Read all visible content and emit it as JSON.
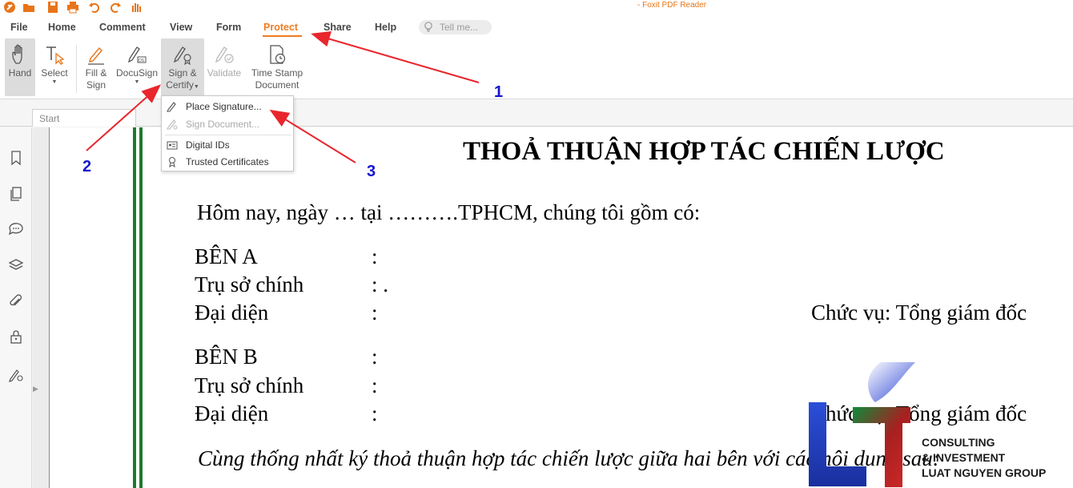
{
  "app_title": "- Foxit PDF Reader",
  "menu": {
    "tabs": [
      "File",
      "Home",
      "Comment",
      "View",
      "Form",
      "Protect",
      "Share",
      "Help"
    ],
    "active_tab": "Protect",
    "tell_me_placeholder": "Tell me..."
  },
  "ribbon": {
    "hand": "Hand",
    "select": "Select",
    "fill_sign": [
      "Fill &",
      "Sign"
    ],
    "docusign": "DocuSign",
    "sign_certify": [
      "Sign &",
      "Certify"
    ],
    "validate": "Validate",
    "time_stamp": [
      "Time Stamp",
      "Document"
    ]
  },
  "doc_tab": {
    "label": "Start"
  },
  "dropdown": {
    "place_signature": "Place Signature...",
    "sign_document": "Sign Document...",
    "digital_ids": "Digital IDs",
    "trusted_certificates": "Trusted Certificates"
  },
  "document": {
    "title": "THOẢ THUẬN HỢP TÁC CHIẾN LƯỢC",
    "intro": "Hôm nay, ngày  … tại ……….TPHCM, chúng tôi gồm có:",
    "party_a": {
      "label": "BÊN A",
      "colon": ":"
    },
    "office_a": {
      "label": "Trụ sở chính",
      "colon": ": ."
    },
    "rep_a": {
      "label": "Đại diện",
      "colon": ":",
      "position": "Chức vụ: Tổng giám đốc"
    },
    "party_b": {
      "label": "BÊN B",
      "colon": ":"
    },
    "office_b": {
      "label": "Trụ sở chính",
      "colon": ":"
    },
    "rep_b": {
      "label": "Đại diện",
      "colon": ":",
      "position": "Chức vụ: Tổng giám đốc"
    },
    "closing": "Cùng thống nhất ký thoả thuận hợp tác chiến lược giữa hai bên với các nội dung sau:"
  },
  "annotations": [
    "1",
    "2",
    "3"
  ],
  "watermark_logo": {
    "lines": [
      "CONSULTING",
      "& INVESTMENT",
      "LUAT NGUYEN GROUP"
    ]
  },
  "colors": {
    "accent": "#f07c22",
    "arrow": "#e8262c",
    "annotation_number": "#1515d0",
    "margin_lines": "#1e7a2c"
  }
}
